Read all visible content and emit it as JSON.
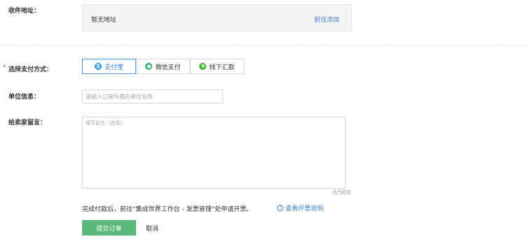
{
  "address": {
    "label": "收件地址：",
    "empty_text": "暂无地址",
    "add_link": "前往添加"
  },
  "payment": {
    "required_mark": "*",
    "label": "选择支付方式：",
    "selected": "支付宝",
    "options": [
      {
        "label": "支付宝",
        "icon": "alipay-icon",
        "icon_glyph": "支",
        "color": "#1e93e9"
      },
      {
        "label": "微信支付",
        "icon": "wechat-icon",
        "icon_glyph": "●",
        "color": "#2aae67"
      },
      {
        "label": "线下汇款",
        "icon": "offline-transfer-icon",
        "icon_glyph": "¥",
        "color": "#45b035"
      }
    ]
  },
  "unit_info": {
    "label": "单位信息：",
    "placeholder": "请输入订单所属的单位名称",
    "value": ""
  },
  "seller_message": {
    "label": "给卖家留言：",
    "placeholder": "填写留言（选填）",
    "value": "",
    "counter": "0/500"
  },
  "notice": {
    "text": "完成付款后，前往“集成世界工作台 - 发票管理”处申请开票。",
    "help_link": "查看开票说明",
    "help_icon_glyph": "?"
  },
  "actions": {
    "submit": "提交订单",
    "cancel": "取消"
  },
  "colors": {
    "accent": "#3f7fc6",
    "submit": "#5cb87a",
    "required": "#e64340"
  }
}
